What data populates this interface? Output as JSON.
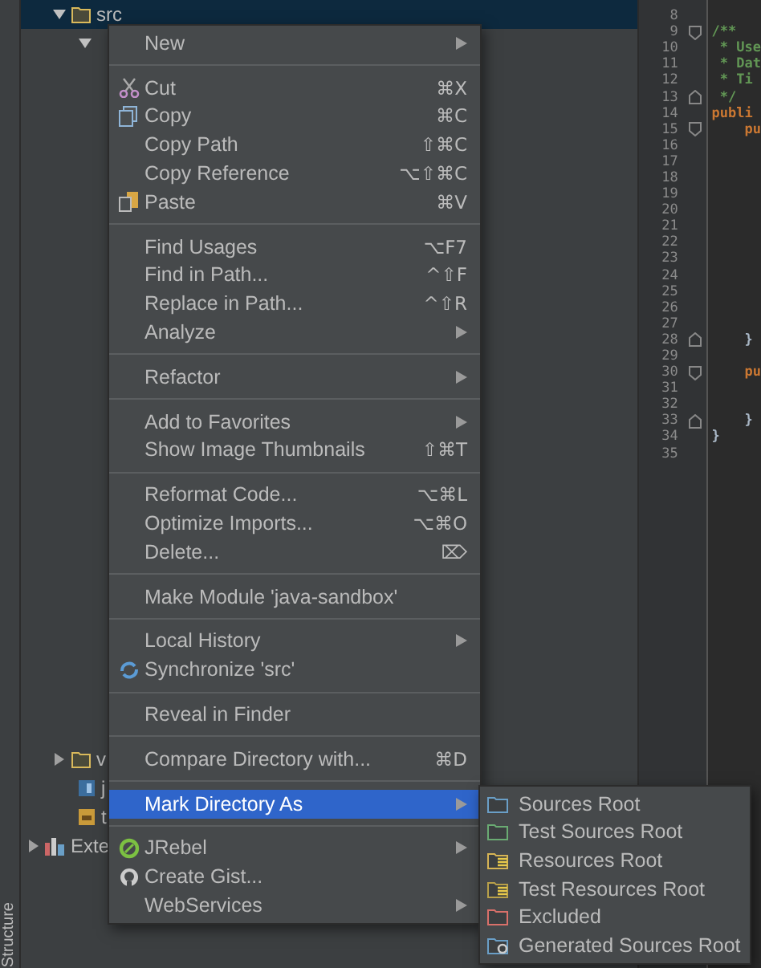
{
  "side_strip": {
    "label": "Structure"
  },
  "tree": [
    {
      "label": "src",
      "kind": "folder",
      "expanded": true,
      "selected": true,
      "children": [
        {
          "expanded": true
        }
      ]
    }
  ],
  "tree_bottom": [
    {
      "label": "v",
      "kind": "folder",
      "expanded": false,
      "selected": false
    },
    {
      "label": "j",
      "kind": "java",
      "selected": false
    },
    {
      "label": "t",
      "kind": "config",
      "selected": false
    }
  ],
  "libraries": {
    "label": "Exte",
    "expanded": false
  },
  "editor": {
    "lines": [
      {
        "number": "8",
        "fold_start": false,
        "fold_end": false
      },
      {
        "number": "9",
        "text": "/**",
        "kind": "comment",
        "fold_start": true,
        "fold_end": false
      },
      {
        "number": "10",
        "text": " * Use",
        "kind": "comment",
        "fold_start": false,
        "fold_end": false
      },
      {
        "number": "11",
        "text": " * Dat",
        "kind": "comment",
        "fold_start": false,
        "fold_end": false
      },
      {
        "number": "12",
        "text": " * Ti",
        "kind": "comment",
        "fold_start": false,
        "fold_end": false
      },
      {
        "number": "13",
        "text": " */",
        "kind": "comment",
        "fold_start": false,
        "fold_end": true
      },
      {
        "number": "14",
        "text": "publi",
        "kind": "keyword",
        "fold_start": false,
        "fold_end": false
      },
      {
        "number": "15",
        "text": "    pu",
        "kind": "keyword",
        "fold_start": true,
        "fold_end": false
      },
      {
        "number": "16",
        "fold_start": false,
        "fold_end": false
      },
      {
        "number": "17",
        "fold_start": false,
        "fold_end": false
      },
      {
        "number": "18",
        "fold_start": false,
        "fold_end": false
      },
      {
        "number": "19",
        "fold_start": false,
        "fold_end": false
      },
      {
        "number": "20",
        "fold_start": false,
        "fold_end": false
      },
      {
        "number": "21",
        "fold_start": false,
        "fold_end": false
      },
      {
        "number": "22",
        "fold_start": false,
        "fold_end": false
      },
      {
        "number": "23",
        "fold_start": false,
        "fold_end": false
      },
      {
        "number": "24",
        "fold_start": false,
        "fold_end": false
      },
      {
        "number": "25",
        "fold_start": false,
        "fold_end": false
      },
      {
        "number": "26",
        "fold_start": false,
        "fold_end": false
      },
      {
        "number": "27",
        "fold_start": false,
        "fold_end": false
      },
      {
        "number": "28",
        "text": "    }",
        "kind": "plain",
        "fold_start": false,
        "fold_end": true
      },
      {
        "number": "29",
        "fold_start": false,
        "fold_end": false
      },
      {
        "number": "30",
        "text": "    pu",
        "kind": "keyword",
        "fold_start": true,
        "fold_end": false
      },
      {
        "number": "31",
        "fold_start": false,
        "fold_end": false
      },
      {
        "number": "32",
        "fold_start": false,
        "fold_end": false
      },
      {
        "number": "33",
        "text": "    }",
        "kind": "plain",
        "fold_start": false,
        "fold_end": true
      },
      {
        "number": "34",
        "text": "}",
        "kind": "plain",
        "fold_start": false,
        "fold_end": false
      },
      {
        "number": "35",
        "fold_start": false,
        "fold_end": false
      }
    ]
  },
  "context_menu": {
    "groups": [
      [
        {
          "label": "New",
          "submenu": true,
          "selected": false
        }
      ],
      [
        {
          "label": "Cut",
          "shortcut": "⌘X",
          "kind": "cut",
          "submenu": false,
          "selected": false
        },
        {
          "label": "Copy",
          "shortcut": "⌘C",
          "kind": "copy",
          "submenu": false,
          "selected": false
        },
        {
          "label": "Copy Path",
          "shortcut": "⇧⌘C",
          "submenu": false,
          "selected": false
        },
        {
          "label": "Copy Reference",
          "shortcut": "⌥⇧⌘C",
          "submenu": false,
          "selected": false
        },
        {
          "label": "Paste",
          "shortcut": "⌘V",
          "kind": "paste",
          "submenu": false,
          "selected": false
        }
      ],
      [
        {
          "label": "Find Usages",
          "shortcut": "⌥F7",
          "submenu": false,
          "selected": false
        },
        {
          "label": "Find in Path...",
          "shortcut": "^⇧F",
          "submenu": false,
          "selected": false
        },
        {
          "label": "Replace in Path...",
          "shortcut": "^⇧R",
          "submenu": false,
          "selected": false
        },
        {
          "label": "Analyze",
          "submenu": true,
          "selected": false
        }
      ],
      [
        {
          "label": "Refactor",
          "submenu": true,
          "selected": false
        }
      ],
      [
        {
          "label": "Add to Favorites",
          "submenu": true,
          "selected": false
        },
        {
          "label": "Show Image Thumbnails",
          "shortcut": "⇧⌘T",
          "submenu": false,
          "selected": false
        }
      ],
      [
        {
          "label": "Reformat Code...",
          "shortcut": "⌥⌘L",
          "submenu": false,
          "selected": false
        },
        {
          "label": "Optimize Imports...",
          "shortcut": "⌥⌘O",
          "submenu": false,
          "selected": false
        },
        {
          "label": "Delete...",
          "shortcut": "⌦",
          "submenu": false,
          "selected": false
        }
      ],
      [
        {
          "label": "Make Module 'java-sandbox'",
          "submenu": false,
          "selected": false
        }
      ],
      [
        {
          "label": "Local History",
          "submenu": true,
          "selected": false
        },
        {
          "label": "Synchronize 'src'",
          "kind": "sync",
          "submenu": false,
          "selected": false
        }
      ],
      [
        {
          "label": "Reveal in Finder",
          "submenu": false,
          "selected": false
        }
      ],
      [
        {
          "label": "Compare Directory with...",
          "shortcut": "⌘D",
          "submenu": false,
          "selected": false
        }
      ],
      [
        {
          "label": "Mark Directory As",
          "submenu": true,
          "selected": true
        }
      ],
      [
        {
          "label": "JRebel",
          "kind": "jrebel",
          "submenu": true,
          "selected": false
        },
        {
          "label": "Create Gist...",
          "kind": "gist",
          "submenu": false,
          "selected": false
        },
        {
          "label": "WebServices",
          "submenu": true,
          "selected": false
        }
      ]
    ]
  },
  "submenu": {
    "items": [
      {
        "label": "Sources Root",
        "kind": "folder",
        "color": "#6a9fc7"
      },
      {
        "label": "Test Sources Root",
        "kind": "folder",
        "color": "#6aab73"
      },
      {
        "label": "Resources Root",
        "kind": "resources",
        "color": "#d6b455"
      },
      {
        "label": "Test Resources Root",
        "kind": "resources",
        "color": "#b8a04a"
      },
      {
        "label": "Excluded",
        "kind": "folder",
        "color": "#d9706a"
      },
      {
        "label": "Generated Sources Root",
        "kind": "generated",
        "color": "#6a9fc7"
      }
    ]
  }
}
